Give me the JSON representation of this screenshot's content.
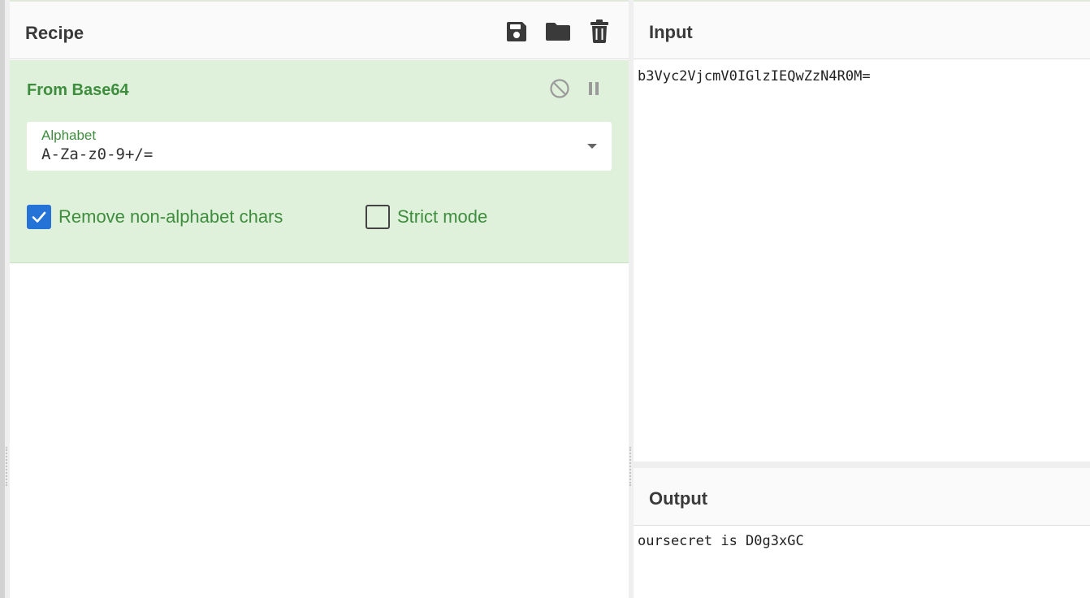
{
  "recipe": {
    "title": "Recipe",
    "toolbar": [
      {
        "name": "save-icon"
      },
      {
        "name": "folder-icon"
      },
      {
        "name": "trash-icon"
      }
    ],
    "operation": {
      "title": "From Base64",
      "controls": [
        {
          "name": "disable-icon"
        },
        {
          "name": "pause-icon"
        }
      ],
      "alphabet": {
        "label": "Alphabet",
        "value": "A-Za-z0-9+/="
      },
      "checkboxes": [
        {
          "label": "Remove non-alphabet chars",
          "checked": true
        },
        {
          "label": "Strict mode",
          "checked": false
        }
      ]
    }
  },
  "input": {
    "title": "Input",
    "text": "b3Vyc2VjcmV0IGlzIEQwZzN4R0M="
  },
  "output": {
    "title": "Output",
    "text": "oursecret is D0g3xGC"
  },
  "colors": {
    "operation_bg": "#dff1da",
    "operation_text": "#3e8d3e",
    "checkbox_checked": "#2673d8"
  }
}
